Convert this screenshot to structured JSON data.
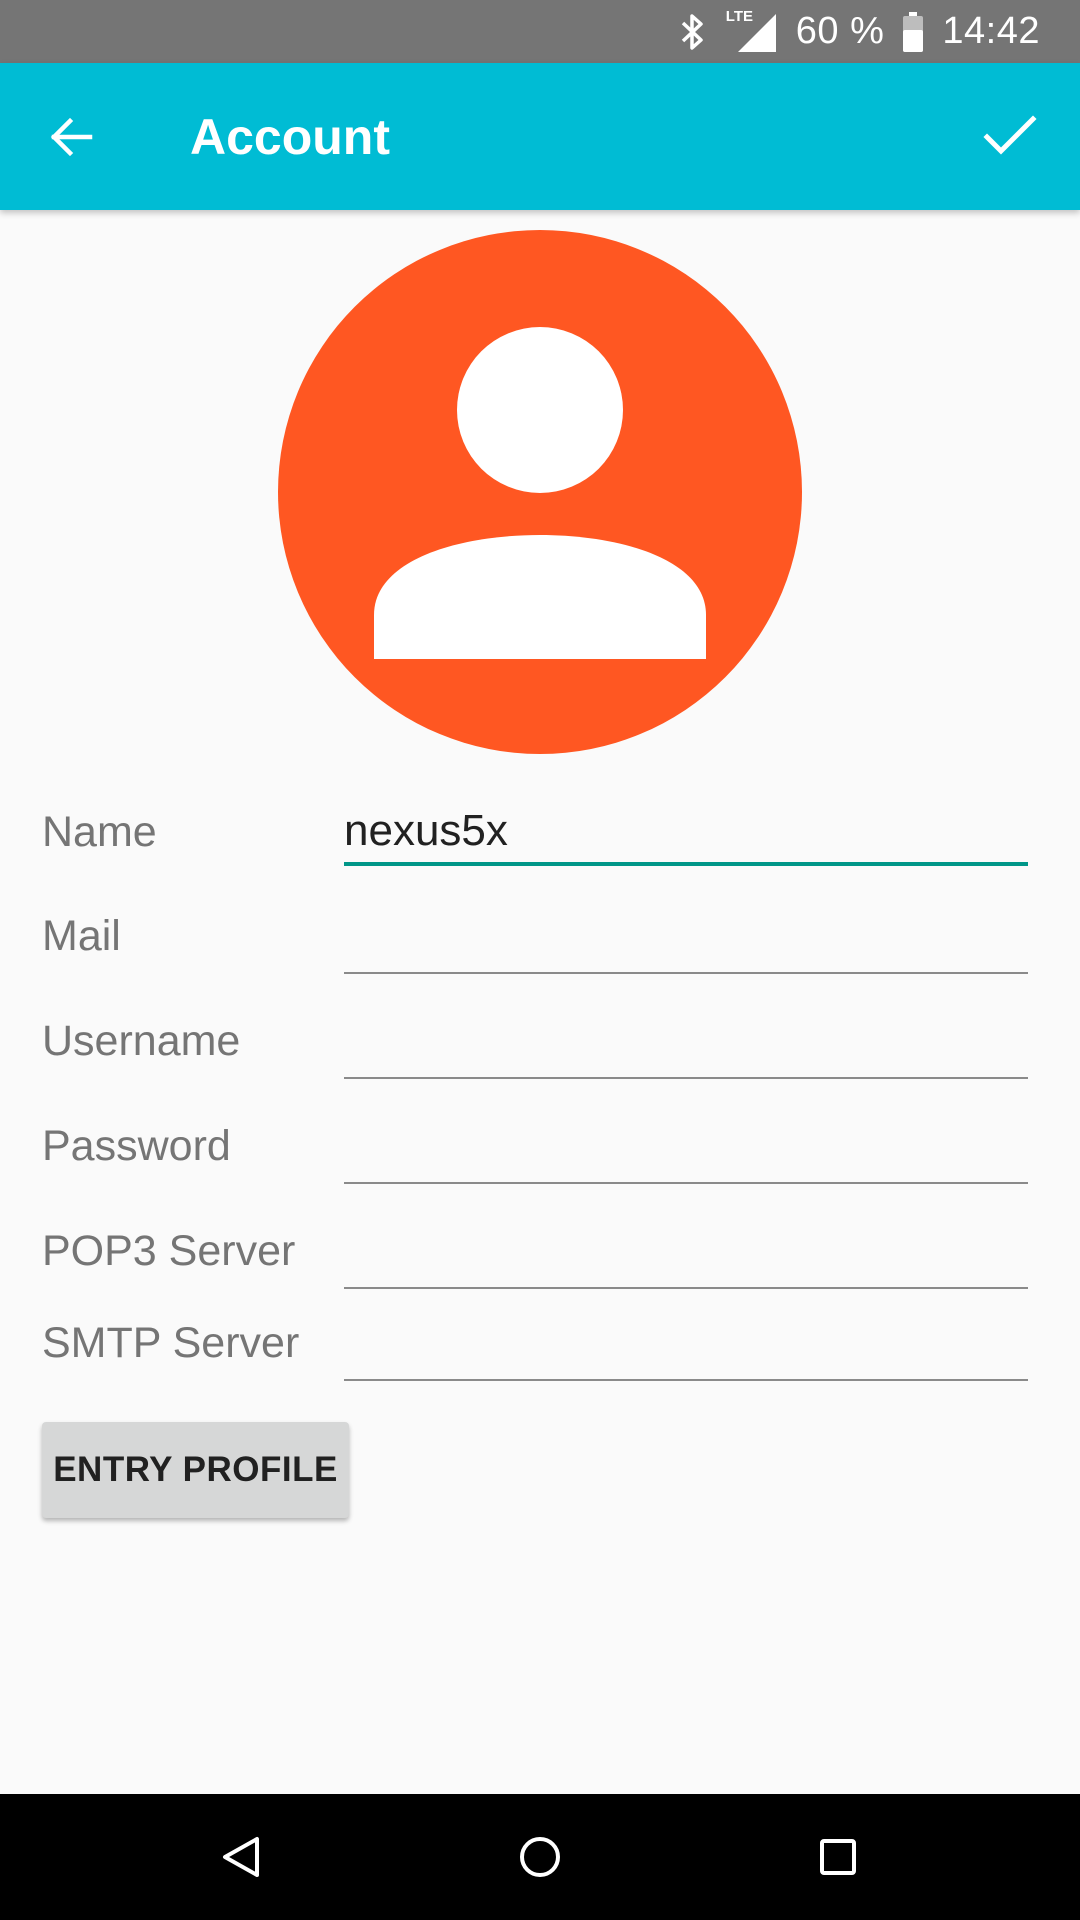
{
  "status_bar": {
    "bluetooth_icon": "bluetooth-icon",
    "network_label": "LTE",
    "signal_icon": "signal-icon",
    "battery": "60 %",
    "battery_icon": "battery-icon",
    "time": "14:42"
  },
  "app_bar": {
    "back_icon": "arrow-back-icon",
    "title": "Account",
    "confirm_icon": "check-icon",
    "background_color": "#00bcd4"
  },
  "avatar": {
    "icon": "person-icon",
    "color": "#ff5722"
  },
  "form": {
    "name": {
      "label": "Name",
      "value": "nexus5x"
    },
    "mail": {
      "label": "Mail",
      "value": ""
    },
    "username": {
      "label": "Username",
      "value": ""
    },
    "password": {
      "label": "Password",
      "value": ""
    },
    "pop3": {
      "label": "POP3 Server",
      "value": ""
    },
    "smtp": {
      "label": "SMTP Server",
      "value": ""
    }
  },
  "entry_button": {
    "label": "ENTRY PROFILE"
  },
  "nav_bar": {
    "back_icon": "triangle-back-icon",
    "home_icon": "circle-home-icon",
    "recents_icon": "square-recents-icon"
  },
  "accent_color": "#009688"
}
